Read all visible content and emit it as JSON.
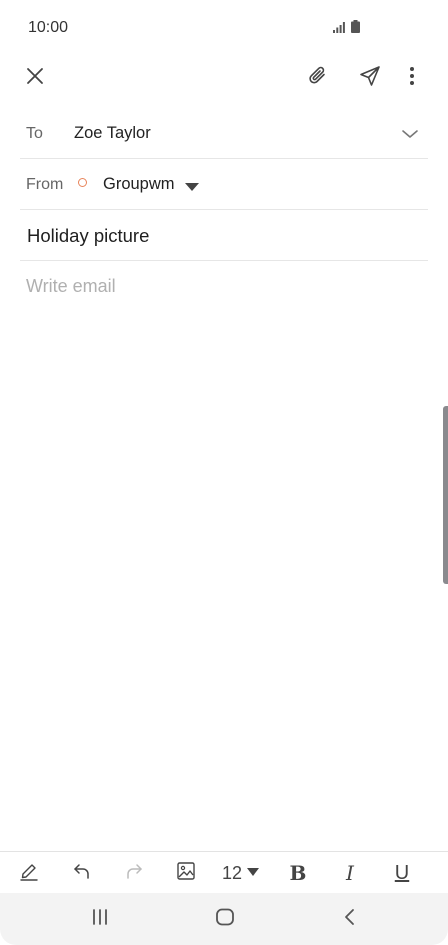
{
  "status_bar": {
    "time": "10:00",
    "icons": [
      "signal-icon",
      "battery-icon"
    ]
  },
  "toolbar": {
    "close_icon": "close-icon",
    "attach_icon": "paperclip-icon",
    "send_icon": "send-icon",
    "more_icon": "more-vertical-icon"
  },
  "compose": {
    "to_label": "To",
    "to_value": "Zoe Taylor",
    "from_label": "From",
    "from_value": "Groupwm",
    "subject": "Holiday picture",
    "body_placeholder": "Write email"
  },
  "format_bar": {
    "font_size": "12",
    "bold_label": "B",
    "italic_label": "I",
    "underline_label": "U",
    "icons": [
      "pen-icon",
      "undo-icon",
      "redo-icon",
      "image-icon"
    ]
  },
  "nav_bar": {
    "icons": [
      "recent-apps-icon",
      "home-icon",
      "back-icon"
    ]
  },
  "colors": {
    "account_dot": "#e8845a",
    "divider": "#e6e6e6",
    "placeholder": "#b0b0b0"
  }
}
